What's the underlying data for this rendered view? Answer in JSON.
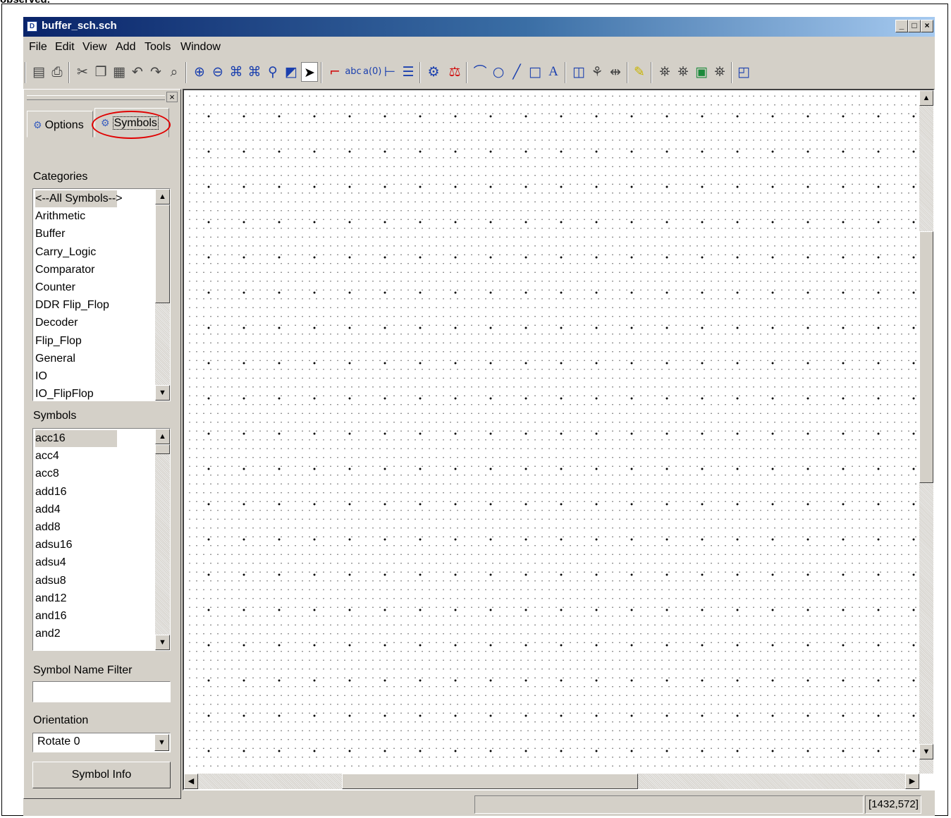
{
  "caption": "observed.",
  "window": {
    "title": "buffer_sch.sch",
    "app_icon": "schematic-icon"
  },
  "caption_buttons": [
    "_",
    "□",
    "×"
  ],
  "menu": [
    "File",
    "Edit",
    "View",
    "Add",
    "Tools",
    "Window"
  ],
  "toolbar_icons": [
    "save-icon",
    "print-icon",
    "cut-icon",
    "copy-icon",
    "paste-icon",
    "undo-icon",
    "redo-icon",
    "find-icon",
    "zoom-in-icon",
    "zoom-out-icon",
    "zoom-full-icon",
    "zoom-fit-icon",
    "zoom-selection-icon",
    "refresh-icon",
    "select-pointer-icon",
    "add-wire-icon",
    "add-net-name-icon",
    "add-bus-tap-icon",
    "add-bus-icon",
    "add-io-marker-icon",
    "add-symbol-icon",
    "add-instance-icon",
    "add-arc-icon",
    "add-circle-icon",
    "add-line-icon",
    "add-rectangle-icon",
    "add-text-icon",
    "check-schematic-icon",
    "symbol-wizard-icon",
    "mirror-icon",
    "highlight-icon",
    "push-into-icon",
    "pop-out-icon",
    "view-hdl-icon",
    "view-symbol-icon",
    "window-layout-icon"
  ],
  "tabs": {
    "options": "Options",
    "symbols": "Symbols",
    "active": "Symbols"
  },
  "categories": {
    "label": "Categories",
    "items": [
      "<--All Symbols-->",
      "Arithmetic",
      "Buffer",
      "Carry_Logic",
      "Comparator",
      "Counter",
      "DDR Flip_Flop",
      "Decoder",
      "Flip_Flop",
      "General",
      "IO",
      "IO_FlipFlop"
    ],
    "selected": "<--All Symbols-->"
  },
  "symbols": {
    "label": "Symbols",
    "items": [
      "acc16",
      "acc4",
      "acc8",
      "add16",
      "add4",
      "add8",
      "adsu16",
      "adsu4",
      "adsu8",
      "and12",
      "and16",
      "and2"
    ],
    "selected": "acc16"
  },
  "filter": {
    "label": "Symbol Name Filter",
    "value": ""
  },
  "orientation": {
    "label": "Orientation",
    "value": "Rotate 0"
  },
  "symbol_info_button": "Symbol Info",
  "status": {
    "coordinates": "[1432,572]"
  }
}
